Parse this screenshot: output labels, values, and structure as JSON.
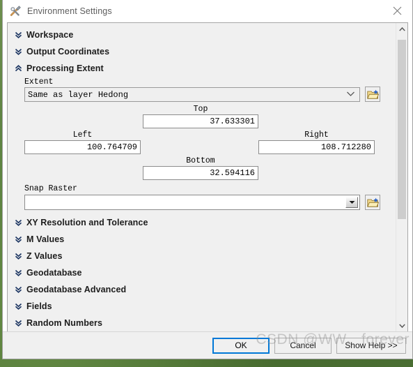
{
  "window": {
    "title": "Environment Settings",
    "icon": "tools-hammer-wrench-icon",
    "close_icon": "close-icon"
  },
  "sections": [
    {
      "label": "Workspace",
      "expanded": false
    },
    {
      "label": "Output Coordinates",
      "expanded": false
    },
    {
      "label": "Processing Extent",
      "expanded": true
    }
  ],
  "sections_lower": [
    {
      "label": "XY Resolution and Tolerance",
      "expanded": false
    },
    {
      "label": "M Values",
      "expanded": false
    },
    {
      "label": "Z Values",
      "expanded": false
    },
    {
      "label": "Geodatabase",
      "expanded": false
    },
    {
      "label": "Geodatabase Advanced",
      "expanded": false
    },
    {
      "label": "Fields",
      "expanded": false
    },
    {
      "label": "Random Numbers",
      "expanded": false
    }
  ],
  "processing_extent": {
    "extent_label": "Extent",
    "extent_value": "Same as layer Hedong",
    "extent_browse_icon": "open-folder-icon",
    "top": {
      "label": "Top",
      "value": "37.633301"
    },
    "left": {
      "label": "Left",
      "value": "100.764709"
    },
    "right": {
      "label": "Right",
      "value": "108.712280"
    },
    "bottom": {
      "label": "Bottom",
      "value": "32.594116"
    },
    "snap_raster": {
      "label": "Snap Raster",
      "value": "",
      "placeholder": "",
      "dropdown_icon": "dropdown-arrow-icon",
      "browse_icon": "open-folder-icon"
    }
  },
  "buttons": {
    "ok": "OK",
    "cancel": "Cancel",
    "show_help": "Show Help >>"
  },
  "watermark": "CSDN @WW、forever",
  "colors": {
    "accent": "#0078d7",
    "section_text": "#1c1c1c",
    "chevron": "#1f3864",
    "dialog_bg": "#f0f0f0",
    "desktop": "#5d8242"
  }
}
